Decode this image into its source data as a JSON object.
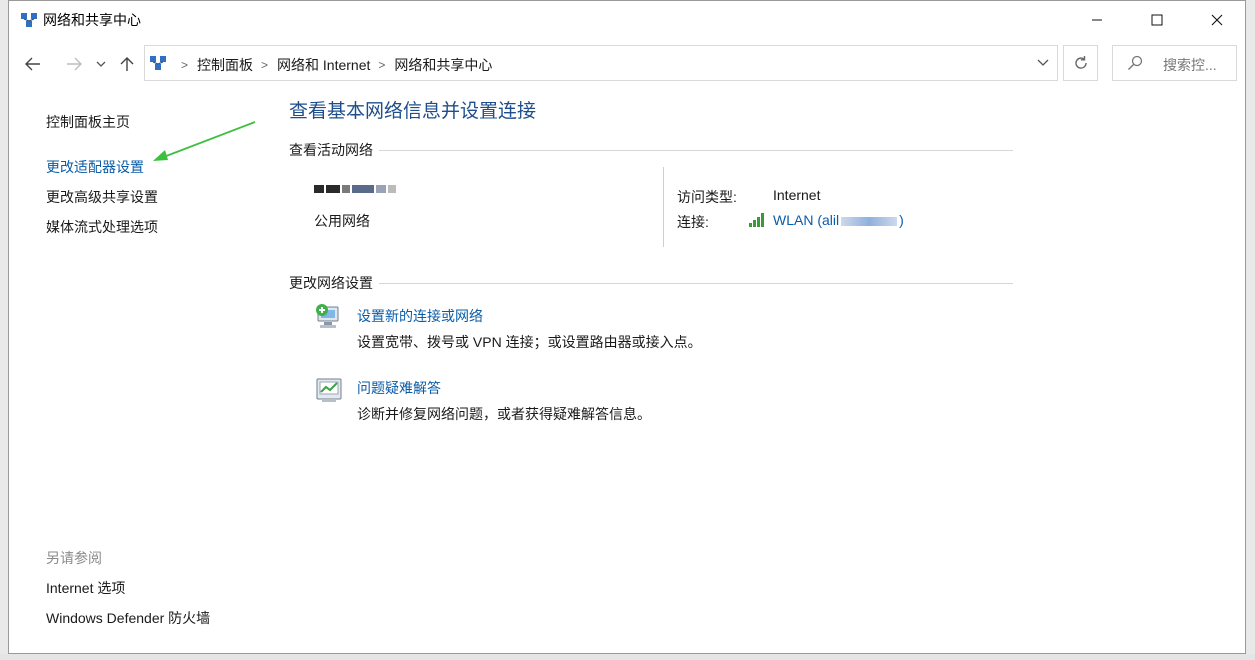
{
  "window": {
    "title": "网络和共享中心",
    "minimize_icon": "minimize-icon",
    "maximize_icon": "maximize-icon",
    "close_icon": "close-icon"
  },
  "nav": {
    "back_icon": "back-arrow-icon",
    "forward_icon": "forward-arrow-icon",
    "recent_icon": "chevron-down-icon",
    "up_icon": "up-arrow-icon",
    "refresh_icon": "refresh-icon"
  },
  "breadcrumb": [
    "控制面板",
    "网络和 Internet",
    "网络和共享中心"
  ],
  "search": {
    "placeholder": "搜索控..."
  },
  "left_pane": {
    "home": "控制面板主页",
    "adapter_settings": "更改适配器设置",
    "advanced_sharing": "更改高级共享设置",
    "media_streaming": "媒体流式处理选项",
    "see_also": "另请参阅",
    "internet_options": "Internet 选项",
    "firewall": "Windows Defender 防火墙"
  },
  "main": {
    "title": "查看基本网络信息并设置连接",
    "active_networks_heading": "查看活动网络",
    "network_type": "公用网络",
    "access_type_label": "访问类型:",
    "access_type_value": "Internet",
    "connection_label": "连接:",
    "connection_value": "WLAN (alil",
    "connection_suffix": ")",
    "change_settings_heading": "更改网络设置",
    "task1_link": "设置新的连接或网络",
    "task1_desc": "设置宽带、拨号或 VPN 连接；或设置路由器或接入点。",
    "task2_link": "问题疑难解答",
    "task2_desc": "诊断并修复网络问题，或者获得疑难解答信息。"
  },
  "colors": {
    "link": "#0a5ca8",
    "title": "#1e4e8c",
    "annotation_arrow": "#3fbf3f"
  }
}
